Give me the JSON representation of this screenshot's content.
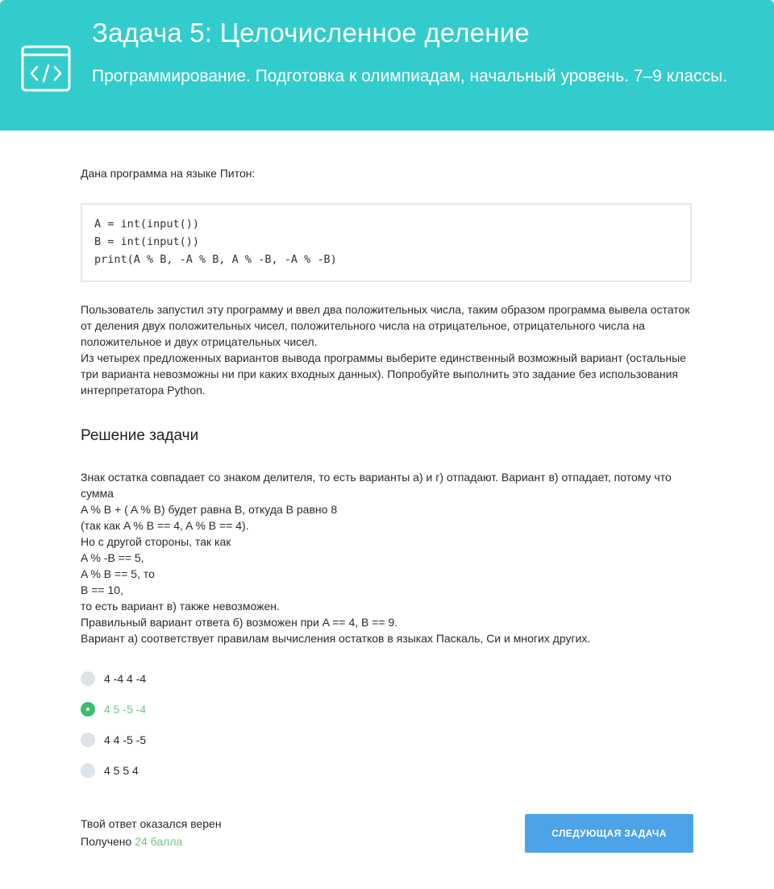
{
  "header": {
    "title": "Задача 5: Целочисленное деление",
    "subtitle": "Программирование. Подготовка к олимпиадам, начальный уровень. 7–9 классы.",
    "icon": "code-window-icon",
    "background_color": "#33cccc"
  },
  "task": {
    "intro": "Дана программа на языке Питон:",
    "code_lines": [
      "A = int(input())",
      "B = int(input())",
      "print(A % B, -A % B, A % -B, -A % -B)"
    ],
    "description": [
      "Пользователь запустил эту программу и ввел два положительных числа, таким образом программа вывела остаток от деления двух положительных чисел, положительного числа на отрицательное, отрицательного числа на положительное и двух отрицательных чисел.",
      "Из четырех предложенных вариантов вывода программы выберите единственный возможный вариант (остальные три варианта невозможны ни при каких входных данных). Попробуйте выполнить это задание без использования интерпретатора Python."
    ]
  },
  "solution": {
    "title": "Решение задачи",
    "lines": [
      "Знак остатка совпадает со знаком делителя, то есть варианты а) и г) отпадают. Вариант в) отпадает, потому что сумма",
      "A % B + ( A % B) будет равна B, откуда B равно 8",
      "(так как A % B == 4, A % B == 4).",
      "Но с другой стороны, так как",
      "A % -B == 5,",
      "A % B == 5, то",
      "B == 10,",
      "то есть вариант в) также невозможен.",
      "Правильный вариант ответа б) возможен при A == 4, B == 9.",
      "Вариант а) соответствует правилам вычисления остатков в языках Паскаль, Си и многих других."
    ]
  },
  "options": [
    {
      "label": "4 -4 4 -4",
      "selected": false
    },
    {
      "label": "4 5 -5 -4",
      "selected": true
    },
    {
      "label": "4 4 -5 -5",
      "selected": false
    },
    {
      "label": "4 5 5 4",
      "selected": false
    }
  ],
  "result": {
    "message": "Твой ответ оказался верен",
    "score_prefix": "Получено",
    "score_value": "24 балла"
  },
  "next_button_label": "СЛЕДУЮЩАЯ ЗАДАЧА",
  "colors": {
    "accent": "#33cccc",
    "correct": "#3cbc6e",
    "button": "#4da3e8"
  }
}
